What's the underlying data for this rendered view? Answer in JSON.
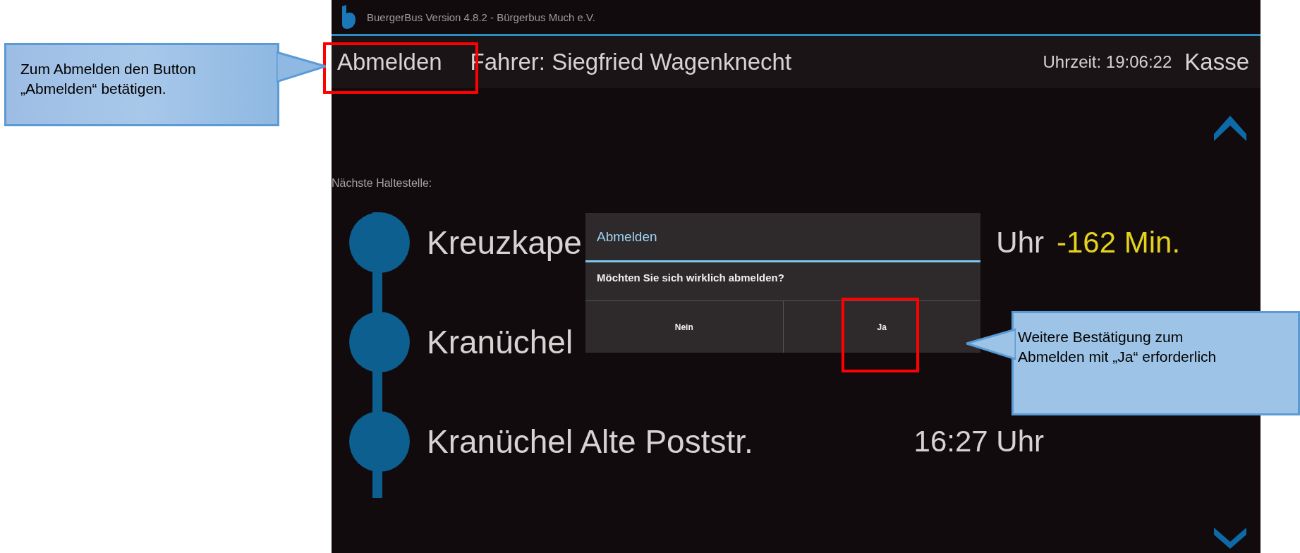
{
  "title_bar": {
    "title": "BuergerBus Version 4.8.2 - Bürgerbus Much e.V."
  },
  "header": {
    "logout_button": "Abmelden",
    "driver": "Fahrer: Siegfried Wagenknecht",
    "clock": "Uhrzeit: 19:06:22",
    "cash_button": "Kasse"
  },
  "stops_label": "Nächste Haltestelle:",
  "stops": [
    {
      "name": "Kreuzkape",
      "time": "Uhr",
      "delay": "-162 Min."
    },
    {
      "name": "Kranüchel"
    },
    {
      "name": "Kranüchel Alte Poststr.",
      "time": "16:27 Uhr"
    }
  ],
  "dialog": {
    "title": "Abmelden",
    "message": "Möchten Sie sich wirklich abmelden?",
    "buttons": [
      "Nein",
      "Ja"
    ]
  },
  "callouts": [
    {
      "lines": [
        "Zum Abmelden den Button",
        "„Abmelden“ betätigen."
      ]
    },
    {
      "lines": [
        "Weitere Bestätigung zum",
        "Abmelden mit „Ja“ erforderlich"
      ]
    }
  ]
}
